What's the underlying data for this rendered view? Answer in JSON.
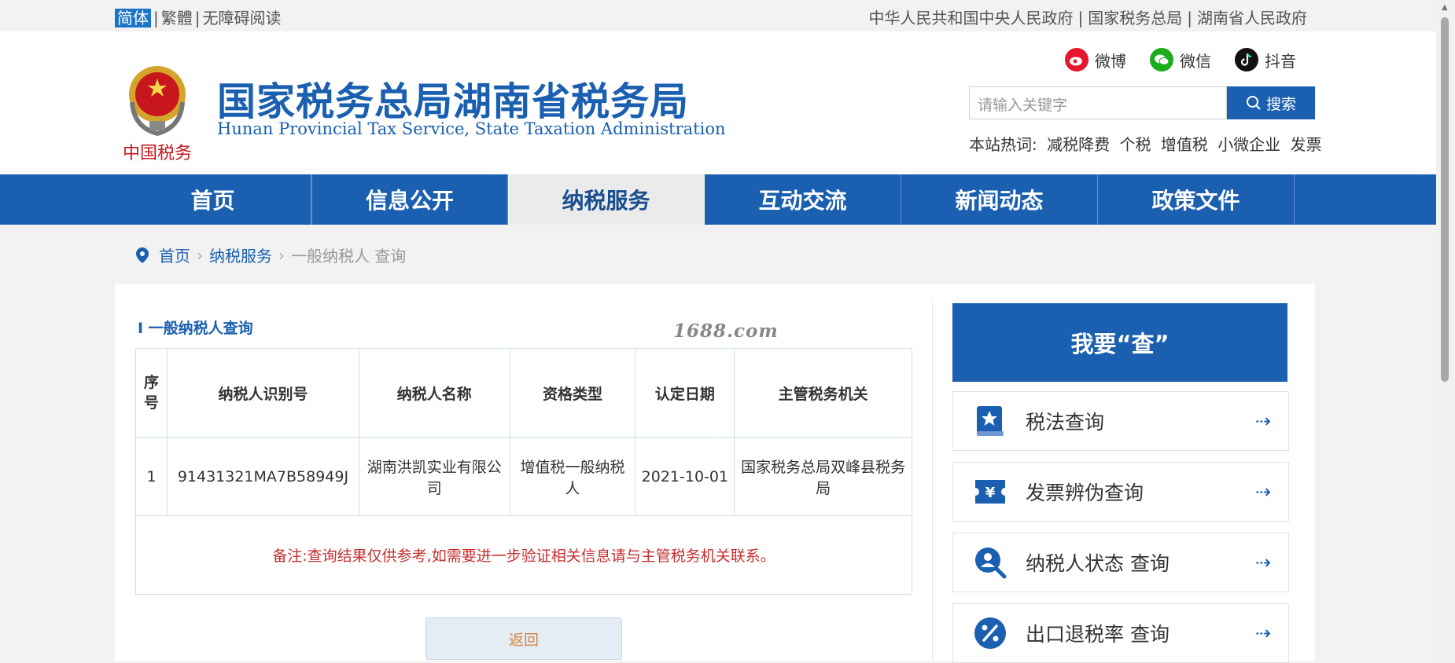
{
  "topbar": {
    "simplified": "简体",
    "traditional": "繁體",
    "accessible": "无障碍阅读",
    "sep": "|",
    "links": [
      "中华人民共和国中央人民政府",
      "国家税务总局",
      "湖南省人民政府"
    ]
  },
  "header": {
    "emblem_text": "中国税务",
    "title_cn": "国家税务总局湖南省税务局",
    "title_en": "Hunan Provincial  Tax Service,  State Taxation Administration",
    "social": [
      {
        "label": "微博",
        "icon": "weibo-icon",
        "color": "#e6162d"
      },
      {
        "label": "微信",
        "icon": "wechat-icon",
        "color": "#1aad19"
      },
      {
        "label": "抖音",
        "icon": "douyin-icon",
        "color": "#111111"
      }
    ],
    "search_placeholder": "请输入关键字",
    "search_button": "搜索",
    "hot_label": "本站热词:",
    "hot_words": [
      "减税降费",
      "个税",
      "增值税",
      "小微企业",
      "发票"
    ]
  },
  "nav": {
    "items": [
      "首页",
      "信息公开",
      "纳税服务",
      "互动交流",
      "新闻动态",
      "政策文件"
    ],
    "active_index": 2
  },
  "breadcrumb": {
    "items": [
      "首页",
      "纳税服务",
      "一般纳税人 查询"
    ]
  },
  "main": {
    "section_title": "I 一般纳税人查询",
    "watermark": "1688.com",
    "table": {
      "headers": [
        "序号",
        "纳税人识别号",
        "纳税人名称",
        "资格类型",
        "认定日期",
        "主管税务机关"
      ],
      "rows": [
        [
          "1",
          "91431321MA7B58949J",
          "湖南洪凯实业有限公司",
          "增值税一般纳税人",
          "2021-10-01",
          "国家税务总局双峰县税务局"
        ]
      ],
      "note": "备注:查询结果仅供参考,如需要进一步验证相关信息请与主管税务机关联系。"
    },
    "back_button": "返回"
  },
  "sidebar": {
    "title": "我要“查”",
    "items": [
      {
        "label": "税法查询",
        "icon": "tax-law-book-icon"
      },
      {
        "label": "发票辨伪查询",
        "icon": "invoice-yuan-icon"
      },
      {
        "label": "纳税人状态 查询",
        "icon": "taxpayer-search-icon"
      },
      {
        "label": "出口退税率 查询",
        "icon": "percent-icon"
      }
    ],
    "arrow": "⇢"
  },
  "colors": {
    "brand": "#1a5fb0",
    "note_red": "#c62f2f",
    "back_text": "#d5883b"
  }
}
